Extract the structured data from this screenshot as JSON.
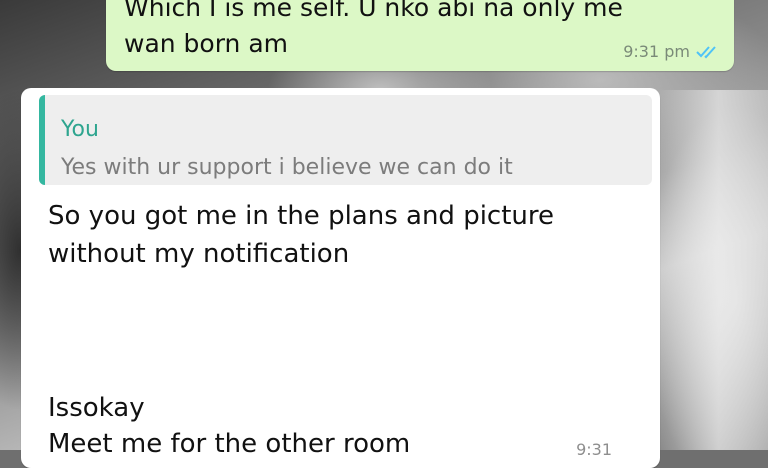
{
  "outgoing_message": {
    "text": "Which I is me self. U nko abi na only me\nwan born am",
    "time": "9:31 pm",
    "status_icon": "double-check-icon",
    "bubble_color": "#dcf8c6",
    "tick_color": "#4fc3f7"
  },
  "incoming_message": {
    "quoted": {
      "author": "You",
      "text": "Yes with ur support i believe we can do it",
      "accent_color": "#34b7a0"
    },
    "text_part1": "So you got me in the plans and picture\nwithout my notification",
    "text_part2": "Issokay\nMeet me for the other room",
    "time": "9:31"
  }
}
